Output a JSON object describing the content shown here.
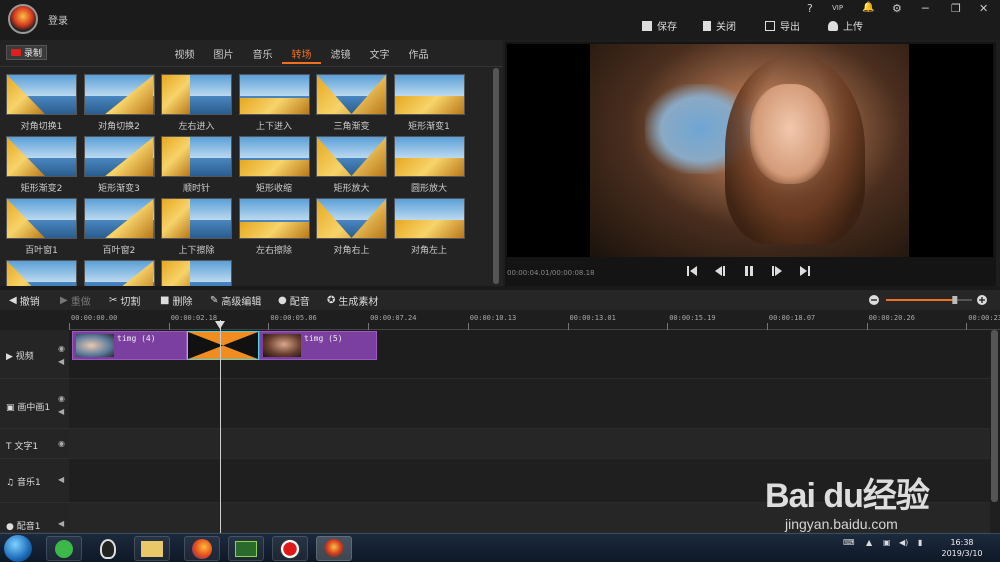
{
  "app": {
    "login_label": "登录",
    "window_controls": [
      "?",
      "VIP",
      "🔔",
      "⚙",
      "─",
      "❐",
      "✕"
    ],
    "actions": {
      "save": "保存",
      "close": "关闭",
      "export": "导出",
      "upload": "上传"
    }
  },
  "media": {
    "record_label": "录制",
    "tabs": [
      "视频",
      "图片",
      "音乐",
      "转场",
      "滤镜",
      "文字",
      "作品"
    ],
    "active_tab": "转场",
    "transitions": [
      "对角切换1",
      "对角切换2",
      "左右进入",
      "上下进入",
      "三角渐变",
      "矩形渐变1",
      "矩形渐变2",
      "矩形渐变3",
      "顺时针",
      "矩形收缩",
      "矩形放大",
      "圆形放大",
      "百叶窗1",
      "百叶窗2",
      "上下擦除",
      "左右擦除",
      "对角右上",
      "对角左上",
      "",
      "",
      ""
    ]
  },
  "preview": {
    "timecode": "00:00:04.01/00:00:08.18"
  },
  "toolbar": {
    "undo": "撤销",
    "redo": "重做",
    "cut": "切割",
    "delete": "删除",
    "advanced_edit": "高级编辑",
    "dub": "配音",
    "generate": "生成素材",
    "zoom_level": 0.8
  },
  "timeline": {
    "ruler": [
      "00:00:00.00",
      "00:00:02.18",
      "00:00:05.06",
      "00:00:07.24",
      "00:00:10.13",
      "00:00:13.01",
      "00:00:15.19",
      "00:00:18.07",
      "00:00:20.26",
      "00:00:23."
    ],
    "tracks": [
      "视频",
      "画中画1",
      "文字1",
      "音乐1",
      "配音1"
    ],
    "clips": [
      {
        "label": "timg (4)"
      },
      {
        "label": "timg (5)"
      }
    ]
  },
  "taskbar": {
    "time": "16:38",
    "date": "2019/3/10"
  },
  "watermark": {
    "main": "Bai du经验",
    "sub": "jingyan.baidu.com"
  },
  "colors": {
    "accent": "#f07020",
    "clip": "#7b3fa0",
    "transition": "#f08c20"
  }
}
